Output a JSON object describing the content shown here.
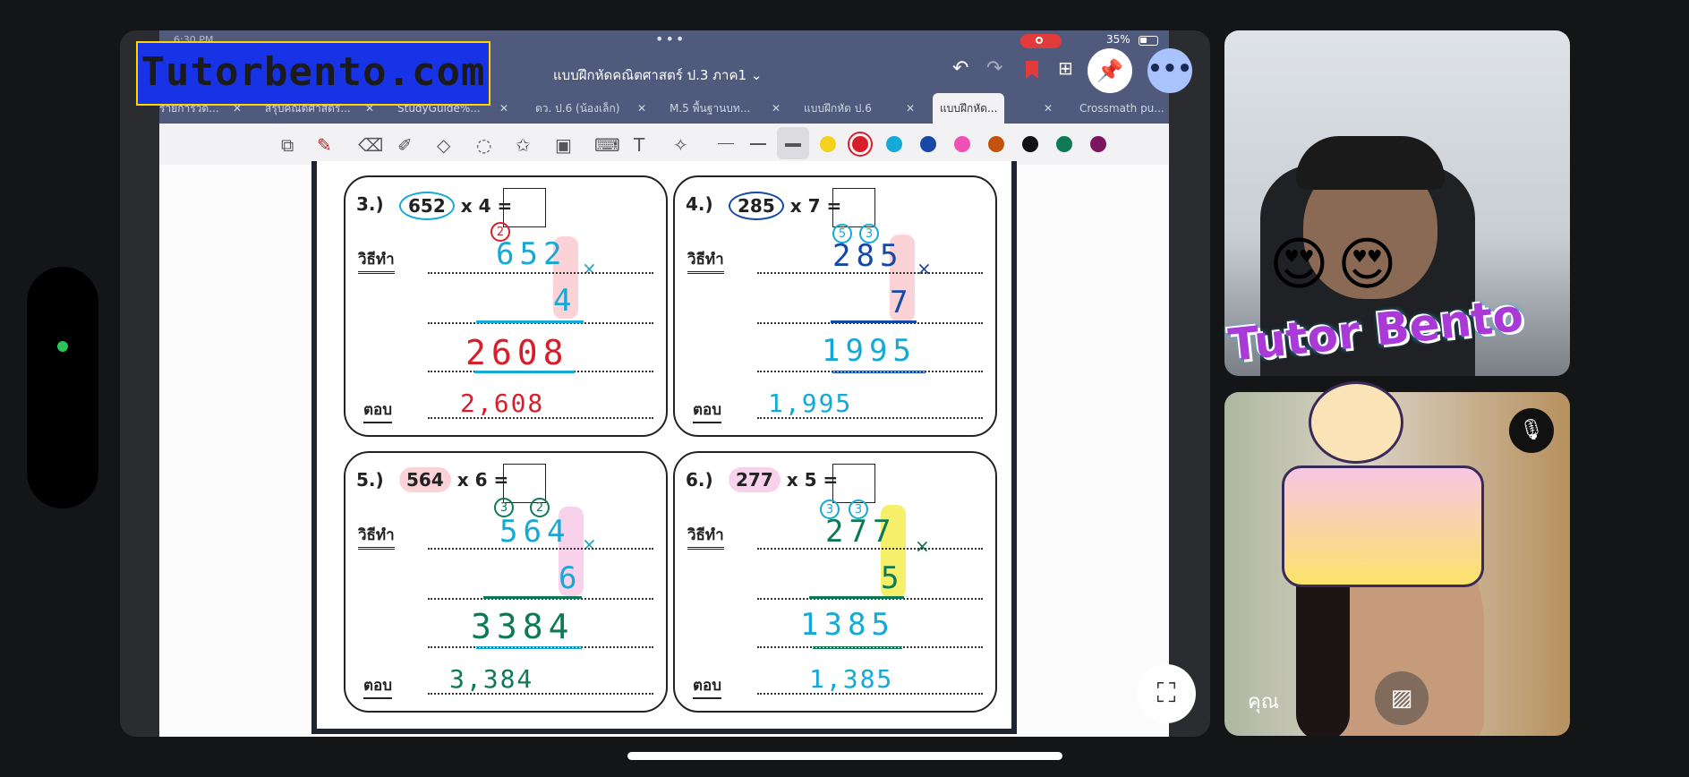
{
  "status": {
    "time": "6:30 PM",
    "battery": "35%"
  },
  "app": {
    "doc_title": "แบบฝึกหัดคณิตศาสตร์ ป.3 ภาค1",
    "tabs": [
      {
        "label": "รายการวัด...",
        "active": false
      },
      {
        "label": "สรุปคณิตศาสตร์...",
        "active": false
      },
      {
        "label": "StudyGuide%...",
        "active": false
      },
      {
        "label": "ตว. ป.6 (น้องเล็ก)",
        "active": false
      },
      {
        "label": "M.5 พื้นฐานบท...",
        "active": false
      },
      {
        "label": "แบบฝึกหัด ป.6",
        "active": false
      },
      {
        "label": "แบบฝึกหัด...",
        "active": true
      },
      {
        "label": "Crossmath pu...",
        "active": false
      }
    ],
    "colors": [
      "#f3d21c",
      "#d81e2a",
      "#14a9d6",
      "#1648a8",
      "#f04fb4",
      "#c4520f",
      "#111111",
      "#0e7a54",
      "#7b1461"
    ]
  },
  "logo": {
    "text": "Tutorbento.com"
  },
  "worksheet": {
    "method_label": "วิธีทำ",
    "answer_label": "ตอบ",
    "problems": [
      {
        "num": "3.)",
        "a": "652",
        "op": "x",
        "b": "4",
        "eq": "=",
        "carries": [
          "2"
        ],
        "top": "652",
        "mult": "4",
        "result": "2608",
        "answer": "2,608"
      },
      {
        "num": "4.)",
        "a": "285",
        "op": "x",
        "b": "7",
        "eq": "=",
        "carries": [
          "5",
          "3"
        ],
        "top": "285",
        "mult": "7",
        "result": "1995",
        "answer": "1,995"
      },
      {
        "num": "5.)",
        "a": "564",
        "op": "x",
        "b": "6",
        "eq": "=",
        "carries": [
          "3",
          "2"
        ],
        "top": "564",
        "mult": "6",
        "result": "3384",
        "answer": "3,384"
      },
      {
        "num": "6.)",
        "a": "277",
        "op": "x",
        "b": "5",
        "eq": "=",
        "carries": [
          "3",
          "3"
        ],
        "top": "277",
        "mult": "5",
        "result": "1385",
        "answer": "1,385"
      }
    ]
  },
  "video": {
    "you_label": "คุณ",
    "sticker_text": "Tutor Bento"
  }
}
